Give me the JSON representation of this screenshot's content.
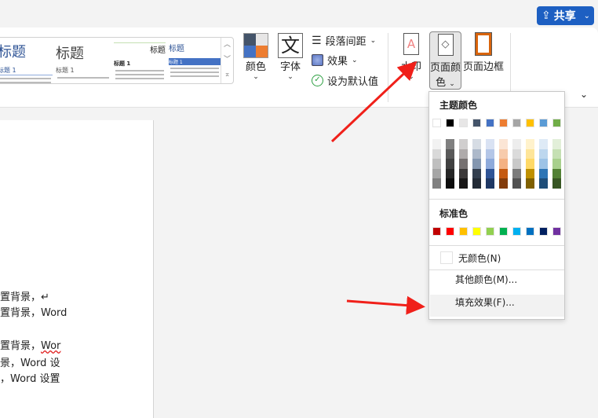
{
  "header": {
    "share_label": "共享",
    "share_icon": "share-icon"
  },
  "gallery": {
    "items": [
      {
        "title": "标题",
        "heading1": "标题 1"
      },
      {
        "title": "标题",
        "heading1": "标题 1"
      },
      {
        "title": "标题",
        "heading1": "标题 1"
      },
      {
        "title": "标题",
        "heading1": "标题 1"
      }
    ]
  },
  "ribbon": {
    "colors_label": "颜色",
    "fonts_label": "字体",
    "fonts_icon_char": "文",
    "paragraph_spacing_label": "段落间距",
    "effects_label": "效果",
    "set_default_label": "设为默认值",
    "watermark_label": "水印",
    "page_color_label": "页面颜",
    "page_color_label2": "色",
    "page_border_label": "页面边框",
    "watermark_glyph": "A"
  },
  "document": {
    "lines": [
      "置背景，↵",
      "置背景，Word",
      "置背景，",
      "Wor",
      "景，Word 设",
      "，Word 设置"
    ]
  },
  "page_color_menu": {
    "theme_title": "主题颜色",
    "theme_colors": [
      "#ffffff",
      "#000000",
      "#e7e6e6",
      "#44546a",
      "#4472c4",
      "#ed7d31",
      "#a5a5a5",
      "#ffc000",
      "#5b9bd5",
      "#70ad47"
    ],
    "theme_shades": [
      [
        "#f2f2f2",
        "#d9d9d9",
        "#bfbfbf",
        "#a6a6a6",
        "#808080"
      ],
      [
        "#808080",
        "#595959",
        "#404040",
        "#262626",
        "#0d0d0d"
      ],
      [
        "#d0cece",
        "#afabab",
        "#767171",
        "#3b3838",
        "#181717"
      ],
      [
        "#d6dce4",
        "#adb9ca",
        "#8497b0",
        "#333f4f",
        "#222a35"
      ],
      [
        "#d9e2f3",
        "#b4c6e7",
        "#8eaadb",
        "#2f5496",
        "#1f3864"
      ],
      [
        "#fbe5d5",
        "#f7cbac",
        "#f4b183",
        "#c55a11",
        "#833c0b"
      ],
      [
        "#ededed",
        "#dbdbdb",
        "#c9c9c9",
        "#7b7b7b",
        "#525252"
      ],
      [
        "#fff2cc",
        "#fee599",
        "#ffd966",
        "#bf9000",
        "#7f6000"
      ],
      [
        "#deeaf6",
        "#bdd7ee",
        "#9dc3e6",
        "#2e75b5",
        "#1f4e79"
      ],
      [
        "#e2efd9",
        "#c5e0b3",
        "#a8d08d",
        "#538135",
        "#375623"
      ]
    ],
    "standard_title": "标准色",
    "standard_colors": [
      "#c00000",
      "#ff0000",
      "#ffc000",
      "#ffff00",
      "#92d050",
      "#00b050",
      "#00b0f0",
      "#0070c0",
      "#002060",
      "#7030a0"
    ],
    "no_color_label": "无颜色(N)",
    "more_colors_label": "其他颜色(M)...",
    "fill_effects_label": "填充效果(F)..."
  },
  "colors": {
    "accent": "#1d5fc2",
    "annotation_arrow": "#f0201a"
  }
}
